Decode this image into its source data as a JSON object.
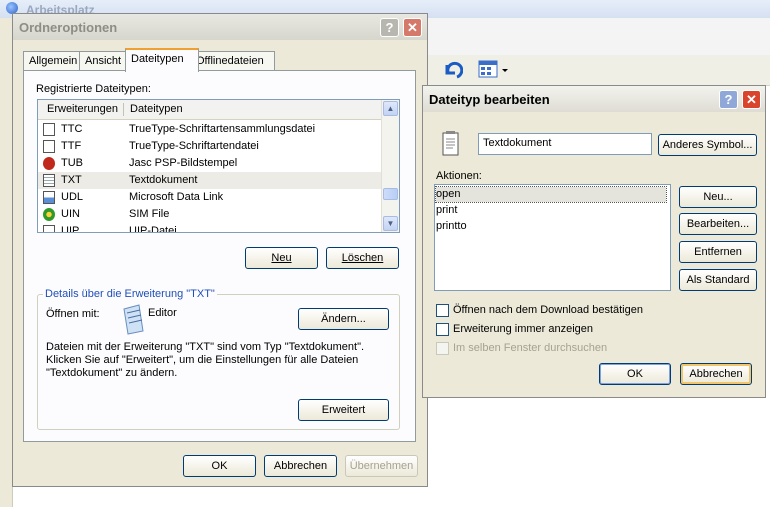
{
  "background": {
    "window_title": "Arbeitsplatz"
  },
  "folder_options": {
    "title": "Ordneroptionen",
    "tabs": [
      {
        "label": "Allgemein"
      },
      {
        "label": "Ansicht"
      },
      {
        "label": "Dateitypen"
      },
      {
        "label": "Offlinedateien"
      }
    ],
    "registered_label": "Registrierte Dateitypen:",
    "columns": [
      "Erweiterungen",
      "Dateitypen"
    ],
    "file_types": [
      {
        "ext": "TTC",
        "type": "TrueType-Schriftartensammlungsdatei",
        "icon": "font-file-icon"
      },
      {
        "ext": "TTF",
        "type": "TrueType-Schriftartendatei",
        "icon": "font-file-icon"
      },
      {
        "ext": "TUB",
        "type": "Jasc PSP-Bildstempel",
        "icon": "jasc-stamp-icon"
      },
      {
        "ext": "TXT",
        "type": "Textdokument",
        "icon": "text-file-icon"
      },
      {
        "ext": "UDL",
        "type": "Microsoft Data Link",
        "icon": "data-link-icon"
      },
      {
        "ext": "UIN",
        "type": "SIM File",
        "icon": "sim-file-icon"
      },
      {
        "ext": "UIP",
        "type": "UIP-Datei",
        "icon": "generic-file-icon"
      }
    ],
    "new_label": "Neu",
    "delete_label": "Löschen",
    "details_caption": "Details über die Erweiterung \"TXT\"",
    "open_with_label": "Öffnen mit:",
    "open_with_app": "Editor",
    "change_label": "Ändern...",
    "description_lines": [
      "Dateien mit der Erweiterung \"TXT\" sind vom Typ \"Textdokument\".",
      "Klicken Sie auf \"Erweitert\", um die Einstellungen für alle Dateien",
      "\"Textdokument\" zu ändern."
    ],
    "advanced_label": "Erweitert",
    "ok_label": "OK",
    "cancel_label": "Abbrechen",
    "apply_label": "Übernehmen"
  },
  "edit_type": {
    "title": "Dateityp bearbeiten",
    "type_name": "Textdokument",
    "change_icon_label": "Anderes Symbol...",
    "actions_label": "Aktionen:",
    "actions": [
      "open",
      "print",
      "printto"
    ],
    "new_label": "Neu...",
    "edit_label": "Bearbeiten...",
    "remove_label": "Entfernen",
    "default_label": "Als Standard",
    "confirm_open_label": "Öffnen nach dem Download bestätigen",
    "always_show_ext_label": "Erweiterung immer anzeigen",
    "browse_same_window_label": "Im selben Fenster durchsuchen",
    "ok_label": "OK",
    "cancel_label": "Abbrechen"
  }
}
